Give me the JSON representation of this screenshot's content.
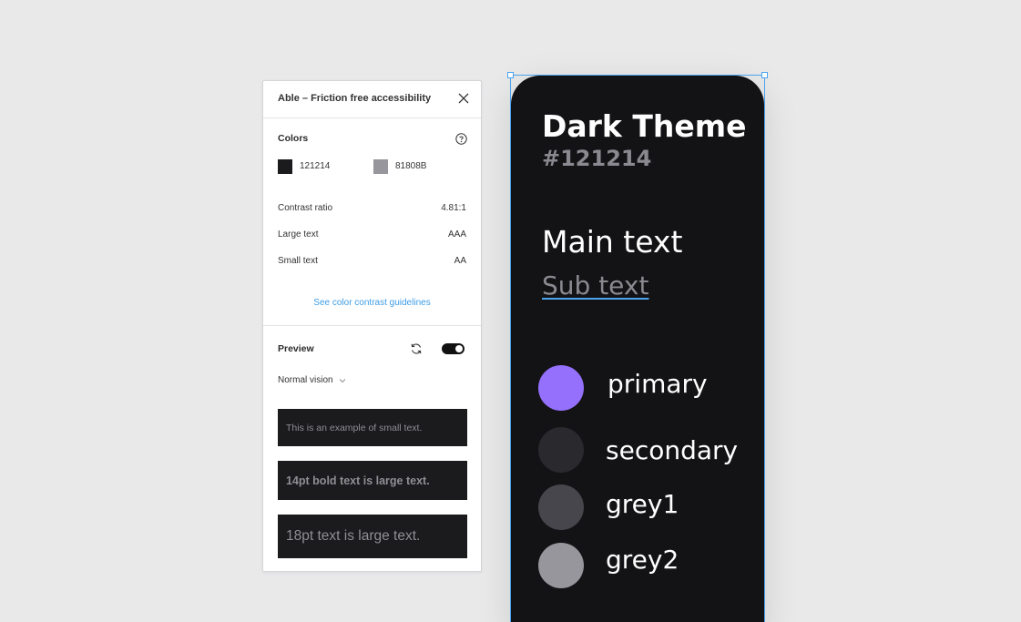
{
  "panel": {
    "title": "Able – Friction free accessibility",
    "colors_label": "Colors",
    "swatches": [
      {
        "code": "121214",
        "color": "#1b1b1d"
      },
      {
        "code": "81808B",
        "color": "#97969c"
      }
    ],
    "contrast_label": "Contrast ratio",
    "contrast_value": "4.81:1",
    "large_label": "Large text",
    "large_value": "AAA",
    "small_label": "Small text",
    "small_value": "AA",
    "guidelines_link": "See color contrast guidelines",
    "preview_label": "Preview",
    "vision_mode": "Normal vision",
    "preview_samples": [
      "This is an example of small text.",
      "14pt bold text is large text.",
      "18pt text is large text."
    ],
    "toggle_on": true
  },
  "phone": {
    "title": "Dark Theme",
    "code": "#121214",
    "main_text": "Main text",
    "sub_text": "Sub text",
    "palette": [
      {
        "label": "primary",
        "color": "#9470fd"
      },
      {
        "label": "secondary",
        "color": "#2a292e"
      },
      {
        "label": "grey1",
        "color": "#47464c"
      },
      {
        "label": "grey2",
        "color": "#97969c"
      }
    ]
  },
  "colors": {
    "canvas_bg": "#e9e9ea",
    "selection": "#4aa3ef",
    "link": "#3d9de6",
    "phone_bg": "#131315"
  }
}
